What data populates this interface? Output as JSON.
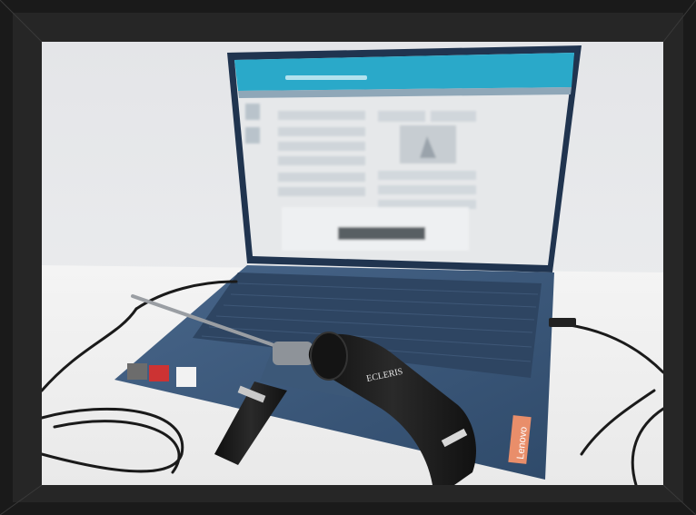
{
  "photo": {
    "laptop_brand": "Lenovo",
    "camera_brand": "ECLERIS",
    "colors": {
      "frame_outer": "#1a1a1a",
      "frame_inner": "#2b2b2b",
      "wall": "#e9eaec",
      "table": "#f1f1f1",
      "laptop_body": "#3a5576",
      "keyboard": "#2e4562",
      "screen_header": "#2aa9c9",
      "screen_bg": "#e6e8ea",
      "camera_body": "#1b1b1b",
      "brand_tag": "#e98e6a"
    }
  }
}
